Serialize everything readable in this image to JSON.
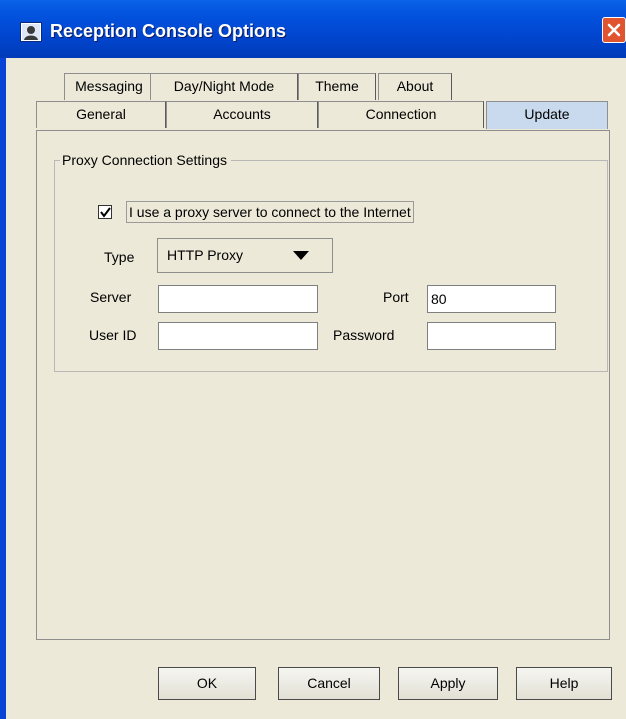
{
  "window": {
    "title": "Reception Console Options",
    "icon": "app-icon",
    "close_icon": "close-icon"
  },
  "tabs": {
    "row_back": [
      "Messaging",
      "Day/Night Mode",
      "Theme",
      "About"
    ],
    "row_front": [
      "General",
      "Accounts",
      "Connection",
      "Update"
    ],
    "active": "Update"
  },
  "proxy": {
    "group_title": "Proxy Connection Settings",
    "use_proxy_label": "I use a proxy server to connect to the Internet",
    "use_proxy_checked": true,
    "type_label": "Type",
    "type_value": "HTTP Proxy",
    "server_label": "Server",
    "server_value": "",
    "port_label": "Port",
    "port_value": "80",
    "userid_label": "User ID",
    "userid_value": "",
    "password_label": "Password",
    "password_value": ""
  },
  "buttons": {
    "ok": "OK",
    "cancel": "Cancel",
    "apply": "Apply",
    "help": "Help"
  },
  "colors": {
    "titlebar": "#0146d0",
    "active_tab": "#c9d9ee",
    "dialog_bg": "#ece9d8",
    "close_button": "#e0542f"
  }
}
